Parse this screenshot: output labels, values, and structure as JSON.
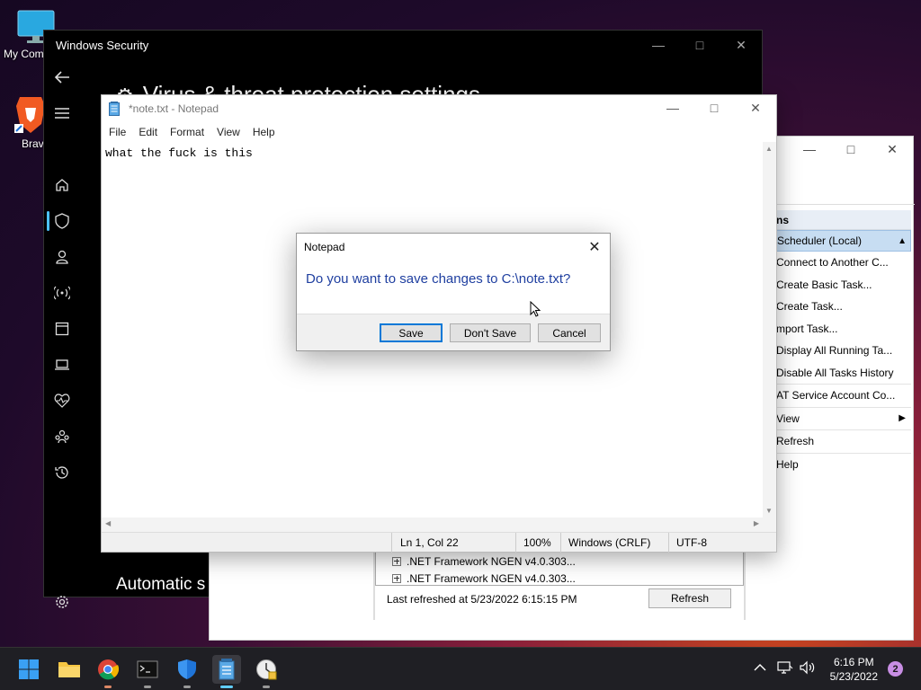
{
  "desktop": {
    "icons": [
      {
        "label": "My Com"
      },
      {
        "label": "Brav"
      }
    ]
  },
  "windows_security": {
    "title": "Windows Security",
    "page_heading": "Virus & threat protection settings",
    "section_heading": "Automatic s"
  },
  "task_scheduler": {
    "actions_header": "ns",
    "group_label": "Scheduler (Local)",
    "actions": [
      "Connect to Another C...",
      "Create Basic Task...",
      "Create Task...",
      "mport Task...",
      "Display All Running Ta...",
      "Disable All Tasks History",
      "AT Service Account Co...",
      "View",
      "Refresh",
      "Help"
    ],
    "list_rows": [
      ".NET Framework NGEN v4.0.303...",
      ".NET Framework NGEN v4.0.303..."
    ],
    "last_refreshed": "Last refreshed at 5/23/2022 6:15:15 PM",
    "refresh_button": "Refresh"
  },
  "notepad": {
    "title": "*note.txt - Notepad",
    "menu": [
      "File",
      "Edit",
      "Format",
      "View",
      "Help"
    ],
    "content": "what the fuck is this",
    "status": {
      "position": "Ln 1, Col 22",
      "zoom": "100%",
      "line_endings": "Windows (CRLF)",
      "encoding": "UTF-8"
    }
  },
  "dialog": {
    "title": "Notepad",
    "message": "Do you want to save changes to C:\\note.txt?",
    "save_label": "Save",
    "dont_save_label": "Don't Save",
    "cancel_label": "Cancel"
  },
  "taskbar": {
    "time": "6:16 PM",
    "date": "5/23/2022",
    "notification_count": "2"
  },
  "colors": {
    "accent": "#0078d7",
    "dialog_text": "#1f3fa0"
  }
}
